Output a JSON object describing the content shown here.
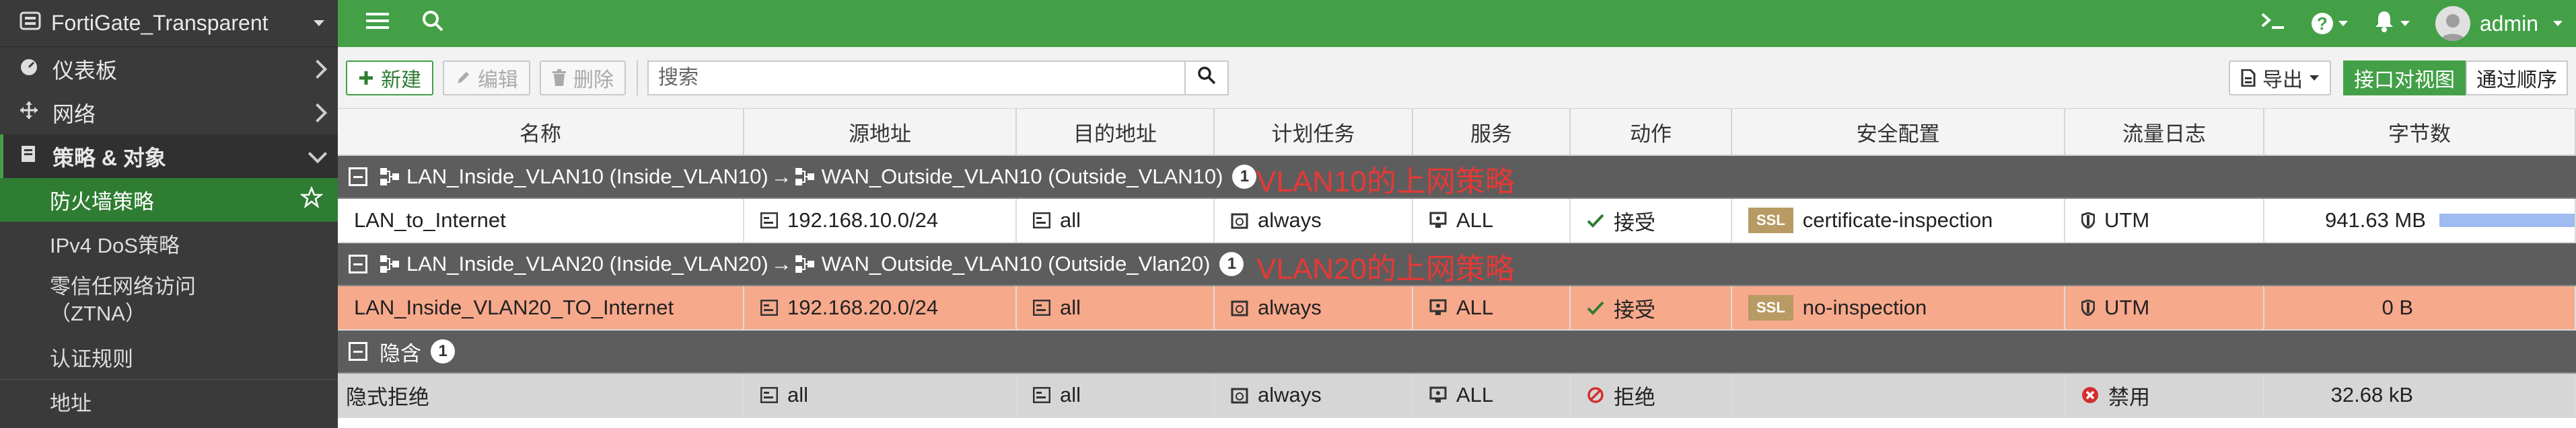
{
  "sidebar": {
    "device": "FortiGate_Transparent",
    "items": [
      {
        "label": "仪表板"
      },
      {
        "label": "网络"
      }
    ],
    "section": {
      "label": "策略 & 对象"
    },
    "sub": [
      {
        "label": "防火墙策略"
      },
      {
        "label": "IPv4 DoS策略"
      },
      {
        "label_l1": "零信任网络访问",
        "label_l2": "（ZTNA）"
      },
      {
        "label": "认证规则"
      },
      {
        "label": "地址"
      }
    ]
  },
  "topbar": {
    "user": "admin"
  },
  "toolbar": {
    "new": "新建",
    "edit": "编辑",
    "delete": "删除",
    "search_placeholder": "搜索",
    "export": "导出",
    "view_interface": "接口对视图",
    "view_sequence": "通过顺序"
  },
  "table": {
    "headers": [
      "名称",
      "源地址",
      "目的地址",
      "计划任务",
      "服务",
      "动作",
      "安全配置",
      "流量日志",
      "字节数"
    ],
    "groups": [
      {
        "src": "LAN_Inside_VLAN10 (Inside_VLAN10)",
        "arrow": "→",
        "dst": "WAN_Outside_VLAN10 (Outside_VLAN10)",
        "count": "1",
        "note": "VLAN10的上网策略",
        "rows": [
          {
            "name": "LAN_to_Internet",
            "src": "192.168.10.0/24",
            "dst": "all",
            "schedule": "always",
            "service": "ALL",
            "action": "接受",
            "ssl_badge": "SSL",
            "security": "certificate-inspection",
            "log": "UTM",
            "bytes": "941.63 MB",
            "bytes_fraction": 1.0
          }
        ]
      },
      {
        "src": "LAN_Inside_VLAN20 (Inside_VLAN20)",
        "arrow": "→",
        "dst": "WAN_Outside_VLAN10 (Outside_Vlan20)",
        "count": "1",
        "note": "VLAN20的上网策略",
        "rows": [
          {
            "name": "LAN_Inside_VLAN20_TO_Internet",
            "src": "192.168.20.0/24",
            "dst": "all",
            "schedule": "always",
            "service": "ALL",
            "action": "接受",
            "ssl_badge": "SSL",
            "security": "no-inspection",
            "log": "UTM",
            "bytes": "0 B"
          }
        ]
      },
      {
        "label": "隐含",
        "count": "1",
        "rows": [
          {
            "name": "隐式拒绝",
            "src": "all",
            "dst": "all",
            "schedule": "always",
            "service": "ALL",
            "action": "拒绝",
            "security": "",
            "log": "禁用",
            "bytes": "32.68 kB"
          }
        ]
      }
    ]
  },
  "colors": {
    "accent": "#43a047",
    "selected_row": "#f7a98c",
    "group_bg": "#5d5d5d",
    "note": "#e53935"
  }
}
